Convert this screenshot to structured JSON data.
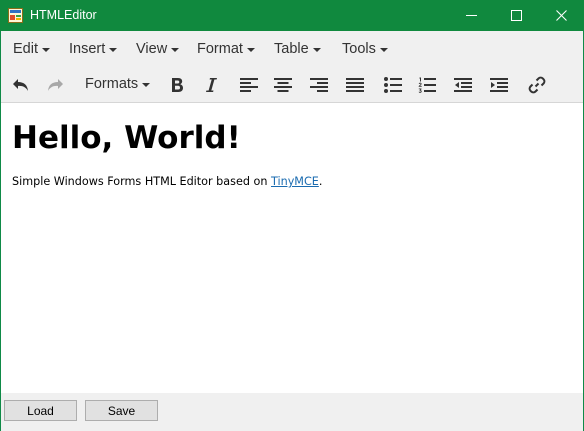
{
  "window": {
    "title": "HTMLEditor",
    "accent_color": "#10893e"
  },
  "titlebar_icons": [
    "app-icon",
    "minimize-icon",
    "maximize-icon",
    "close-icon"
  ],
  "menu": {
    "items": [
      "Edit",
      "Insert",
      "View",
      "Format",
      "Table",
      "Tools"
    ]
  },
  "toolbar": {
    "formats_label": "Formats",
    "icons": [
      "undo-icon",
      "redo-icon",
      "bold-icon",
      "italic-icon",
      "align-left-icon",
      "align-center-icon",
      "align-right-icon",
      "align-justify-icon",
      "bullet-list-icon",
      "numbered-list-icon",
      "outdent-icon",
      "indent-icon",
      "link-icon"
    ]
  },
  "editor": {
    "heading": "Hello, World!",
    "paragraph_prefix": "Simple Windows Forms HTML Editor based on ",
    "link_text": "TinyMCE",
    "paragraph_suffix": ".",
    "link_color": "#1a6bb0"
  },
  "buttons": {
    "load": "Load",
    "save": "Save"
  }
}
